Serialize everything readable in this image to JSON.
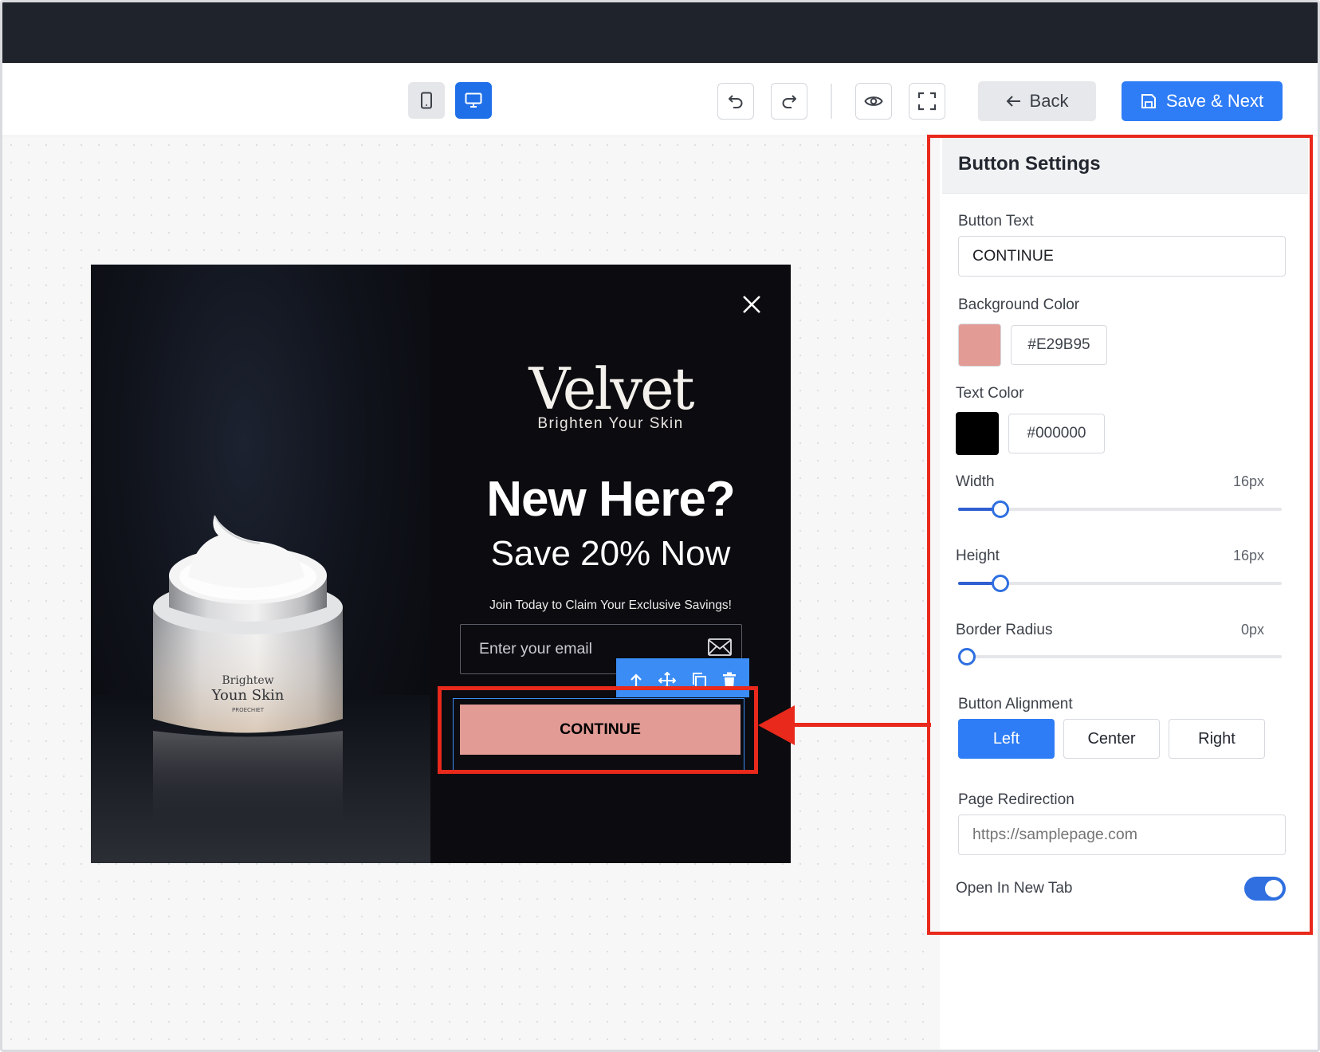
{
  "toolbar": {
    "back_label": "Back",
    "save_label": "Save & Next",
    "icons": [
      "mobile-view-icon",
      "desktop-view-icon",
      "undo-icon",
      "redo-icon",
      "preview-eye-icon",
      "fullscreen-icon"
    ]
  },
  "popup": {
    "brand": "Velvet",
    "tagline": "Brighten Your Skin",
    "headline": "New Here?",
    "subheadline": "Save 20% Now",
    "description": "Join Today to Claim Your Exclusive Savings!",
    "email_placeholder": "Enter your email",
    "button_text": "CONTINUE",
    "jar_label_line1": "Brightew",
    "jar_label_line2": "Youn Skin",
    "jar_label_line3": "PROECHIET"
  },
  "settings": {
    "title": "Button Settings",
    "button_text_label": "Button Text",
    "button_text_value": "CONTINUE",
    "bg_color_label": "Background Color",
    "bg_color_hex": "#E29B95",
    "text_color_label": "Text Color",
    "text_color_hex": "#000000",
    "width_label": "Width",
    "width_value": "16px",
    "width_level": 0.14,
    "height_label": "Height",
    "height_value": "16px",
    "height_level": 0.14,
    "radius_label": "Border Radius",
    "radius_value": "0px",
    "radius_level": 0.0,
    "alignment_label": "Button Alignment",
    "alignment_options": [
      "Left",
      "Center",
      "Right"
    ],
    "alignment_selected": "Left",
    "redirect_label": "Page Redirection",
    "redirect_placeholder": "https://samplepage.com",
    "new_tab_label": "Open In New Tab",
    "new_tab_enabled": true
  },
  "colors": {
    "accent": "#2F7DF6",
    "highlight": "#E8291B",
    "button_bg": "#E29B95"
  }
}
